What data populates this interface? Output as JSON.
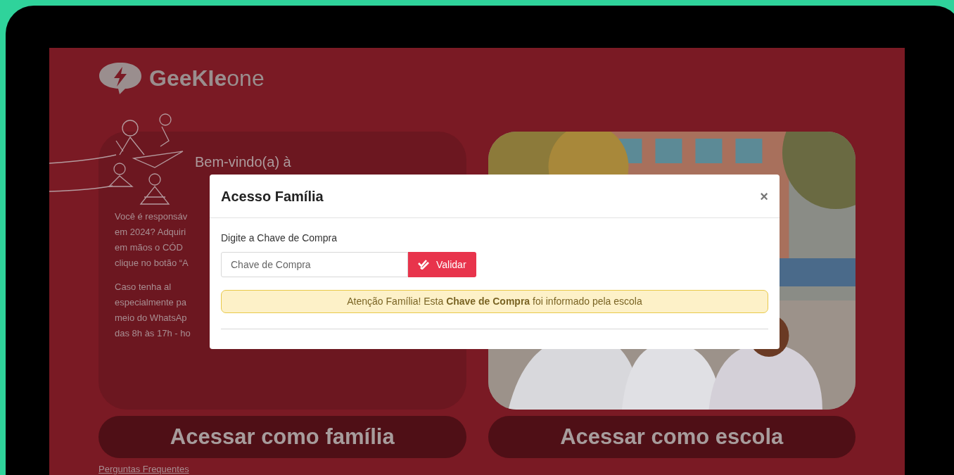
{
  "logo": {
    "word": "GeeKIe",
    "suffix": "one"
  },
  "welcome": {
    "greeting": "Bem-vindo(a) à",
    "paragraphs": [
      [
        "Você é responsáv",
        "em 2024? Adquiri",
        "em mãos o CÓD",
        "clique no botão “A"
      ],
      [
        "Caso tenha al",
        "especialmente pa",
        "meio do WhatsAp",
        "das 8h às 17h - ho"
      ]
    ]
  },
  "access_buttons": [
    "Acessar como família",
    "Acessar como escola"
  ],
  "faq_link": "Perguntas Frequentes",
  "modal": {
    "title": "Acesso Família",
    "close": "×",
    "field_label": "Digite a Chave de Compra",
    "placeholder": "Chave de Compra",
    "submit": "Validar",
    "alert": "Atenção Família! Esta **Chave de Compra** foi informado pela escola"
  }
}
